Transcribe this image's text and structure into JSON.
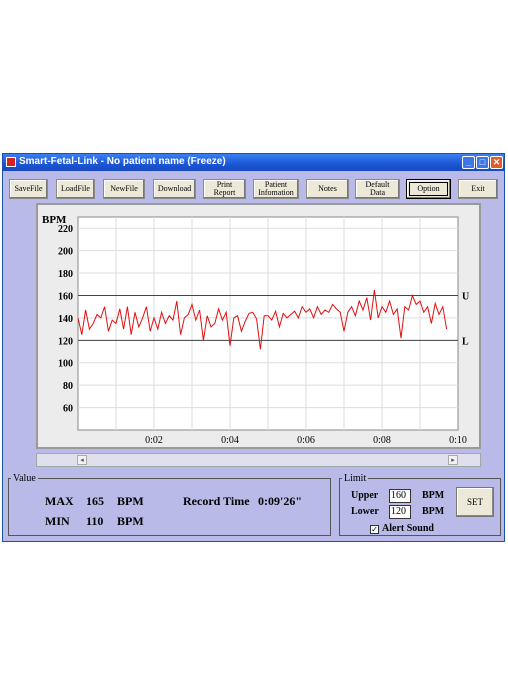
{
  "window": {
    "title": "Smart-Fetal-Link - No patient name (Freeze)"
  },
  "toolbar": [
    {
      "label": "SaveFile"
    },
    {
      "label": "LoadFile"
    },
    {
      "label": "NewFile"
    },
    {
      "label": "Download"
    },
    {
      "label": "Print\nReport"
    },
    {
      "label": "Patient\nInfomation"
    },
    {
      "label": "Notes"
    },
    {
      "label": "Default\nData"
    },
    {
      "label": "Option"
    },
    {
      "label": "Exit"
    }
  ],
  "chart_data": {
    "type": "line",
    "title": "",
    "ylabel": "BPM",
    "xlabel": "",
    "ylim": [
      40,
      230
    ],
    "xlim": [
      0,
      10
    ],
    "y_ticks": [
      60,
      80,
      100,
      120,
      140,
      160,
      180,
      200,
      220
    ],
    "x_ticks": [
      "0:02",
      "0:04",
      "0:06",
      "0:08",
      "0:10"
    ],
    "x_tick_values": [
      2,
      4,
      6,
      8,
      10
    ],
    "grid": true,
    "upper_limit": {
      "value": 160,
      "label": "U"
    },
    "lower_limit": {
      "value": 120,
      "label": "L"
    },
    "series": [
      {
        "color": "#e01010",
        "x": [
          0.0,
          0.1,
          0.2,
          0.3,
          0.4,
          0.5,
          0.6,
          0.7,
          0.8,
          0.9,
          1.0,
          1.1,
          1.2,
          1.3,
          1.4,
          1.5,
          1.6,
          1.7,
          1.8,
          1.9,
          2.0,
          2.1,
          2.2,
          2.3,
          2.4,
          2.5,
          2.6,
          2.7,
          2.8,
          2.9,
          3.0,
          3.1,
          3.2,
          3.3,
          3.4,
          3.5,
          3.6,
          3.7,
          3.8,
          3.9,
          4.0,
          4.1,
          4.2,
          4.3,
          4.4,
          4.5,
          4.6,
          4.7,
          4.8,
          4.9,
          5.0,
          5.1,
          5.2,
          5.3,
          5.4,
          5.5,
          5.6,
          5.7,
          5.8,
          5.9,
          6.0,
          6.1,
          6.2,
          6.3,
          6.4,
          6.5,
          6.6,
          6.7,
          6.8,
          6.9,
          7.0,
          7.1,
          7.2,
          7.3,
          7.4,
          7.5,
          7.6,
          7.7,
          7.8,
          7.9,
          8.0,
          8.1,
          8.2,
          8.3,
          8.4,
          8.5,
          8.6,
          8.7,
          8.8,
          8.9,
          9.0,
          9.1,
          9.2,
          9.3,
          9.4,
          9.5,
          9.6,
          9.7
        ],
        "y": [
          140,
          125,
          147,
          130,
          135,
          143,
          140,
          150,
          128,
          138,
          135,
          148,
          130,
          150,
          125,
          145,
          132,
          140,
          150,
          128,
          140,
          130,
          145,
          135,
          142,
          138,
          155,
          125,
          140,
          143,
          152,
          138,
          147,
          120,
          142,
          132,
          135,
          148,
          138,
          145,
          115,
          140,
          142,
          128,
          137,
          144,
          145,
          139,
          112,
          142,
          142,
          138,
          146,
          132,
          144,
          140,
          143,
          146,
          140,
          150,
          145,
          148,
          140,
          150,
          143,
          147,
          145,
          152,
          148,
          145,
          128,
          145,
          150,
          142,
          155,
          147,
          158,
          138,
          165,
          140,
          150,
          145,
          155,
          143,
          148,
          122,
          150,
          147,
          160,
          152,
          155,
          145,
          150,
          135,
          153,
          143,
          150,
          130
        ]
      }
    ]
  },
  "scrollbar": {
    "left_arrow": "◂",
    "right_arrow": "▸"
  },
  "value_panel": {
    "legend": "Value",
    "max_label": "MAX",
    "max_value": "165",
    "max_unit": "BPM",
    "min_label": "MIN",
    "min_value": "110",
    "min_unit": "BPM",
    "record_label": "Record Time",
    "record_value": "0:09'26\""
  },
  "limit_panel": {
    "legend": "Limit",
    "upper_label": "Upper",
    "upper_value": "160",
    "upper_unit": "BPM",
    "lower_label": "Lower",
    "lower_value": "120",
    "lower_unit": "BPM",
    "set_label": "SET",
    "alert_label": "Alert Sound",
    "alert_checked": true
  }
}
